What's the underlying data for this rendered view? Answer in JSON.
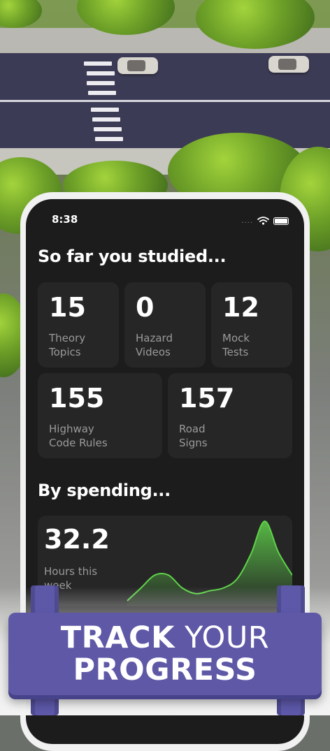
{
  "status_bar": {
    "time": "8:38",
    "dots": "....",
    "wifi_icon": "wifi-icon",
    "battery_icon": "battery-icon"
  },
  "studied": {
    "heading": "So far you studied...",
    "cards": [
      {
        "number": "15",
        "label_line1": "Theory",
        "label_line2": "Topics"
      },
      {
        "number": "0",
        "label_line1": "Hazard",
        "label_line2": "Videos"
      },
      {
        "number": "12",
        "label_line1": "Mock",
        "label_line2": "Tests"
      },
      {
        "number": "155",
        "label_line1": "Highway",
        "label_line2": "Code Rules"
      },
      {
        "number": "157",
        "label_line1": "Road",
        "label_line2": "Signs"
      }
    ]
  },
  "spending": {
    "heading": "By spending...",
    "hours": "32.2",
    "label_line1": "Hours this",
    "label_line2": "week"
  },
  "banner": {
    "word1": "TRACK",
    "word2": "YOUR",
    "word3": "PROGRESS"
  },
  "colors": {
    "accent_green": "#5fd24a",
    "banner_purple": "#5e58a6",
    "screen_bg": "#1c1c1c",
    "card_bg": "#262626"
  },
  "chart_data": {
    "type": "area",
    "x": [
      0,
      1,
      2,
      3,
      4,
      5,
      6,
      7,
      8,
      9,
      10,
      11,
      12
    ],
    "values": [
      4,
      22,
      40,
      40,
      22,
      14,
      18,
      22,
      35,
      70,
      116,
      72,
      40
    ],
    "ylim": [
      0,
      120
    ],
    "grid": false,
    "color": "#5fd24a"
  }
}
